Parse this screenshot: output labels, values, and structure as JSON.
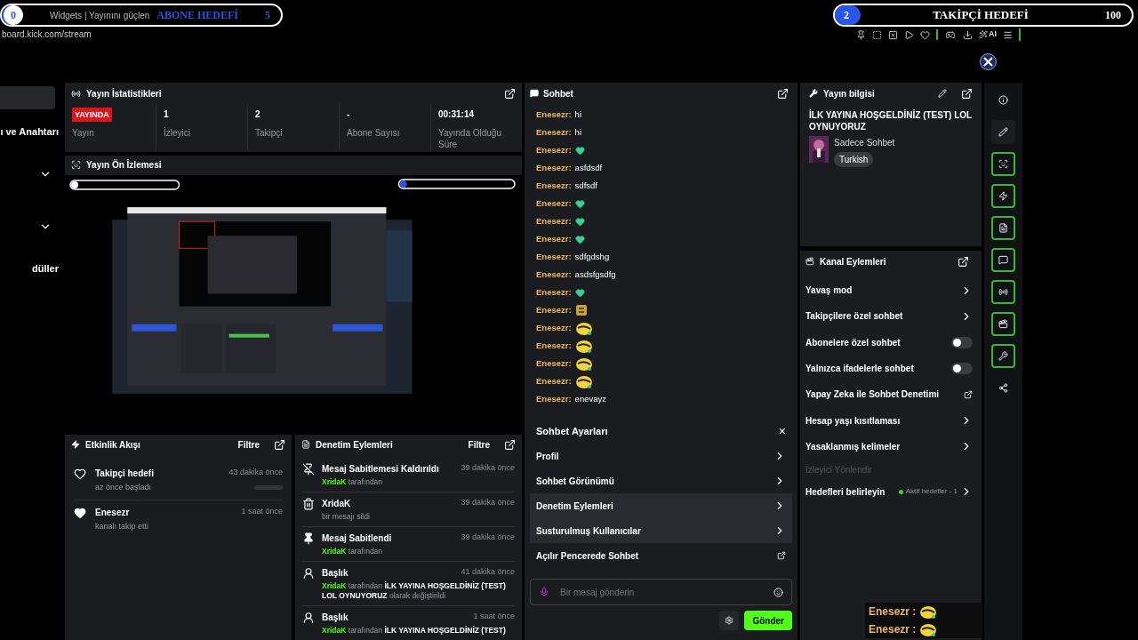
{
  "goal_bars": [
    {
      "count": "0",
      "title": "ABONE HEDEFİ",
      "target": "5",
      "level": 0
    },
    {
      "count": "2",
      "title": "TAKİPÇİ HEDEFİ",
      "target": "100",
      "level": 0.02
    }
  ],
  "browser": {
    "tab": "Widgets | Yayınını güçlen",
    "url": "board.kick.com/stream",
    "ai_label": "AI"
  },
  "left_nav": {
    "items": [
      {
        "kind": "block"
      },
      {
        "label": "ı ve Anahtarı",
        "kind": "text"
      },
      {
        "kind": "chevron"
      },
      {
        "kind": "chevron"
      },
      {
        "label": "düller",
        "kind": "text"
      }
    ]
  },
  "stats": {
    "title": "Yayın İstatistikleri",
    "live_badge": "YAYINDA",
    "cells": [
      {
        "label": "Yayın"
      },
      {
        "value": "1",
        "label": "İzleyici"
      },
      {
        "value": "2",
        "label": "Takipçi"
      },
      {
        "value": "-",
        "label": "Abone Sayısı"
      },
      {
        "value": "00:31:14",
        "label": "Yayında Olduğu Süre"
      }
    ]
  },
  "preview": {
    "title": "Yayın Ön İzlemesi",
    "kind": "picture"
  },
  "activity": {
    "title": "Etkinlik Akışı",
    "filter": "Filtre",
    "items": [
      {
        "kind": "goal",
        "title": "Takipçi hedefi",
        "sub": "az önce başladı",
        "time": "43 dakika önce",
        "level": 0
      },
      {
        "kind": "follow",
        "title": "Enesezr",
        "sub": "kanalı takip etti",
        "time": "1 saat önce"
      }
    ]
  },
  "moderation": {
    "title": "Denetim Eylemleri",
    "filter": "Filtre",
    "items": [
      {
        "kind": "unpin",
        "title": "Mesaj Sabitlemesi Kaldırıldı",
        "time": "39 dakika önce",
        "user": "XridaK",
        "detail": "tarafından"
      },
      {
        "kind": "delete",
        "title": "XridaK",
        "time": "39 dakika önce",
        "detail": "bir mesajı sildi"
      },
      {
        "kind": "pin",
        "title": "Mesaj Sabitlendi",
        "time": "39 dakika önce",
        "user": "XridaK",
        "detail": "tarafından"
      },
      {
        "kind": "title",
        "title": "Başlık",
        "time": "41 dakika önce",
        "user": "XridaK",
        "detail": "tarafından **İLK YAYINA HOŞGELDİNİZ (TEST) LOL OYNUYORUZ** olarak değiştirildi"
      },
      {
        "kind": "title",
        "title": "Başlık",
        "time": "1 saat önce",
        "user": "XridaK",
        "detail": "tarafından **İLK YAYINA HOŞGELDİNİZ (TEST)**"
      }
    ]
  },
  "chat": {
    "title": "Sohbet",
    "messages": [
      {
        "user": "Enesezr:",
        "kind": "text",
        "text": "hi"
      },
      {
        "user": "Enesezr:",
        "kind": "text",
        "text": "hi"
      },
      {
        "user": "Enesezr:",
        "kind": "heart"
      },
      {
        "user": "Enesezr:",
        "kind": "text",
        "text": "asfdsdf"
      },
      {
        "user": "Enesezr:",
        "kind": "text",
        "text": "sdfsdf"
      },
      {
        "user": "Enesezr:",
        "kind": "heart"
      },
      {
        "user": "Enesezr:",
        "kind": "heart"
      },
      {
        "user": "Enesezr:",
        "kind": "heart"
      },
      {
        "user": "Enesezr:",
        "kind": "text",
        "text": "sdfgdshg"
      },
      {
        "user": "Enesezr:",
        "kind": "text",
        "text": "asdsfgsdfg"
      },
      {
        "user": "Enesezr:",
        "kind": "heart"
      },
      {
        "user": "Enesezr:",
        "kind": "sticker"
      },
      {
        "user": "Enesezr:",
        "kind": "blob"
      },
      {
        "user": "Enesezr:",
        "kind": "blob"
      },
      {
        "user": "Enesezr:",
        "kind": "blob"
      },
      {
        "user": "Enesezr:",
        "kind": "blob"
      },
      {
        "user": "Enesezr:",
        "kind": "text",
        "text": "enevayz"
      }
    ],
    "settings": {
      "title": "Sohbet Ayarları",
      "close": "×",
      "items": [
        {
          "label": "Profil",
          "kind": "chevron",
          "highlighted": false
        },
        {
          "label": "Sohbet Görünümü",
          "kind": "chevron",
          "highlighted": false
        },
        {
          "label": "Denetim Eylemleri",
          "kind": "chevron",
          "highlighted": true
        },
        {
          "label": "Susturulmuş Kullanıcılar",
          "kind": "chevron",
          "highlighted": true
        },
        {
          "label": "Açılır Pencerede Sohbet",
          "kind": "external",
          "highlighted": false
        }
      ]
    },
    "input": {
      "placeholder": "Bir mesaj gönderin"
    },
    "send": "Gönder"
  },
  "stream_info": {
    "title": "Yayın bilgisi",
    "stream_title": "İLK YAYINA HOŞGELDİNİZ (TEST) LOL OYNUYORUZ",
    "category": "Sadece Sohbet",
    "tag": "Turkish"
  },
  "channel_actions": {
    "title": "Kanal Eylemleri",
    "items": [
      {
        "label": "Yavaş mod",
        "kind": "chevron"
      },
      {
        "label": "Takipçilere özel sohbet",
        "kind": "chevron"
      },
      {
        "label": "Abonelere özel sohbet",
        "kind": "toggle",
        "on": false
      },
      {
        "label": "Yalnızca ifadelerle sohbet",
        "kind": "toggle",
        "on": false
      },
      {
        "label": "Yapay Zeka ile Sohbet Denetimi",
        "kind": "external"
      },
      {
        "label": "Hesap yaşı kısıtlaması",
        "kind": "chevron"
      },
      {
        "label": "Yasaklanmış kelimeler",
        "kind": "chevron"
      },
      {
        "label": "İzleyici Yönlendir",
        "kind": "section"
      },
      {
        "label": "Hedefleri belirleyin",
        "kind": "status",
        "status": "Aktif hedefler - 1",
        "color": "#3fd33f"
      }
    ]
  },
  "side_tools": [
    {
      "active": false
    },
    {
      "active": false
    },
    {
      "active": true
    },
    {
      "active": true
    },
    {
      "active": true
    },
    {
      "active": true
    },
    {
      "active": true
    },
    {
      "active": true
    },
    {
      "active": true
    },
    {
      "active": false
    }
  ],
  "overlay_chat": [
    {
      "user": "Enesezr :"
    },
    {
      "user": "Enesezr :"
    }
  ]
}
